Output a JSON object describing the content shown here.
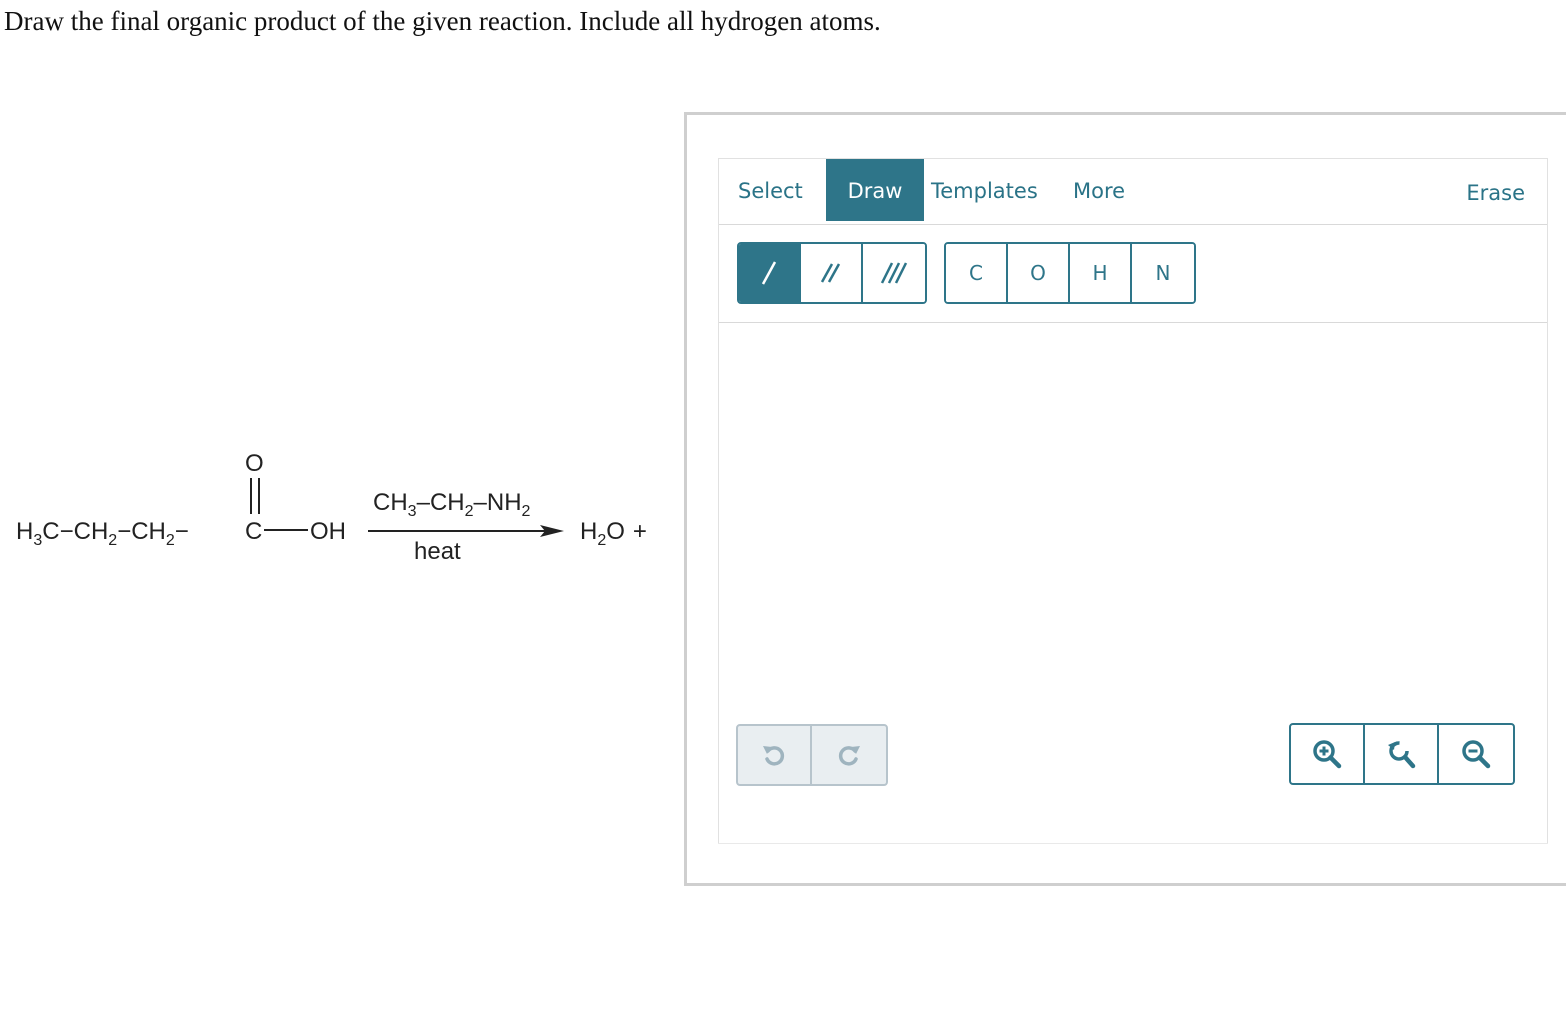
{
  "question": {
    "text": "Draw the final organic product of the given reaction. Include all hydrogen atoms."
  },
  "reaction": {
    "reactant": {
      "h3c": "H",
      "h3c_sub": "3",
      "h3c_c": "C",
      "bond1": "−",
      "ch2a": "CH",
      "ch2a_sub": "2",
      "bond2": "−",
      "ch2b": "CH",
      "ch2b_sub": "2",
      "bond3": "−",
      "carbonyl_c": "C",
      "carbonyl_o": "O",
      "hydroxyl": "OH"
    },
    "reagent": {
      "ch3": "CH",
      "ch3_sub": "3",
      "dash1": "–",
      "ch2": "CH",
      "ch2_sub": "2",
      "dash2": "–",
      "nh2": "NH",
      "nh2_sub": "2"
    },
    "condition": "heat",
    "byproduct": {
      "h": "H",
      "sub": "2",
      "o": "O",
      "plus": "+"
    }
  },
  "editor": {
    "menu": {
      "select": "Select",
      "draw": "Draw",
      "templates": "Templates",
      "more": "More",
      "erase": "Erase"
    },
    "bond_tools": [
      {
        "name": "single-bond",
        "icon": "single-bond-icon",
        "active": true
      },
      {
        "name": "double-bond",
        "icon": "double-bond-icon",
        "active": false
      },
      {
        "name": "triple-bond",
        "icon": "triple-bond-icon",
        "active": false
      }
    ],
    "atoms": [
      "C",
      "O",
      "H",
      "N"
    ],
    "history": [
      {
        "name": "undo",
        "icon": "undo-icon"
      },
      {
        "name": "redo",
        "icon": "redo-icon"
      }
    ],
    "zoom": [
      {
        "name": "zoom-in",
        "icon": "zoom-in-icon"
      },
      {
        "name": "zoom-reset",
        "icon": "zoom-reset-icon"
      },
      {
        "name": "zoom-out",
        "icon": "zoom-out-icon"
      }
    ],
    "colors": {
      "accent": "#2e7589",
      "menu_text": "#2a7387",
      "disabled_bg": "#e9eef1",
      "disabled_icon": "#9fb4bf"
    }
  }
}
